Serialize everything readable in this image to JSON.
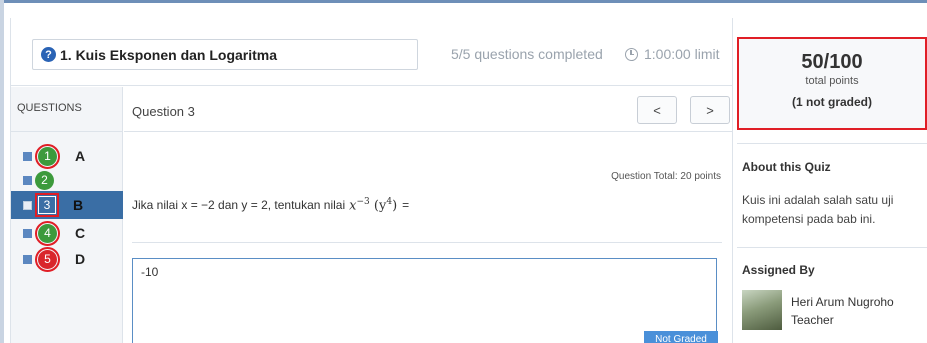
{
  "header": {
    "title": "1. Kuis Eksponen dan Logaritma",
    "progress": "5/5 questions completed",
    "time_limit": "1:00:00 limit"
  },
  "sidebar": {
    "heading": "QUESTIONS",
    "items": [
      {
        "number": "1",
        "letter": "A",
        "status": "correct",
        "circled": true
      },
      {
        "number": "2",
        "letter": "",
        "status": "correct",
        "circled": false
      },
      {
        "number": "3",
        "letter": "B",
        "status": "current",
        "circled": true
      },
      {
        "number": "4",
        "letter": "C",
        "status": "correct",
        "circled": true
      },
      {
        "number": "5",
        "letter": "D",
        "status": "incorrect",
        "circled": true
      }
    ]
  },
  "question": {
    "title": "Question 3",
    "prev_label": "<",
    "next_label": ">",
    "total": "Question Total: 20 points",
    "text": "Jika nilai x = −2 dan y = 2, tentukan nilai",
    "math_base": "x",
    "math_exp": "−3",
    "math_inner": "(y",
    "math_inner_exp": "4",
    "math_close": ")",
    "math_eq": "=",
    "answer": "-10",
    "graded_status": "Not Graded"
  },
  "score": {
    "value": "50/100",
    "label": "total points",
    "not_graded": "(1 not graded)"
  },
  "about": {
    "heading": "About this Quiz",
    "body": "Kuis ini adalah salah satu uji kompetensi pada bab ini."
  },
  "assigned": {
    "heading": "Assigned By",
    "name": "Heri Arum Nugroho",
    "role": "Teacher"
  },
  "colors": {
    "accent": "#3a6ea5",
    "correct": "#3c9a3c",
    "incorrect": "#d9262c",
    "highlight": "#e01e26"
  }
}
